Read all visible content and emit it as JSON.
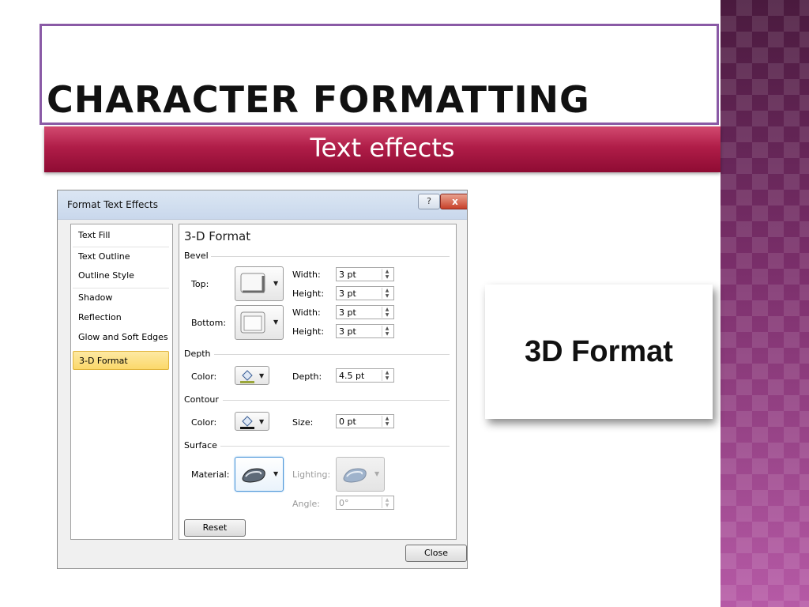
{
  "slide": {
    "title": "CHARACTER FORMATTING",
    "subtitle": "Text effects",
    "callout": "3D Format"
  },
  "colors": {
    "subtitle_bar": "#b01d48",
    "title_border": "#8a5aa6",
    "side_band": "#7a2f6a",
    "active_item": "#fbd86a"
  },
  "dialog": {
    "title": "Format Text Effects",
    "help_label": "?",
    "close_glyph": "x",
    "sidebar": [
      {
        "label": "Text Fill"
      },
      {
        "label": "Text Outline"
      },
      {
        "label": "Outline Style"
      },
      {
        "label": "Shadow"
      },
      {
        "label": "Reflection"
      },
      {
        "label": "Glow and Soft Edges"
      },
      {
        "label": "3-D Format"
      }
    ],
    "active_item": "3-D Format",
    "pane_title": "3-D Format",
    "bevel": {
      "group": "Bevel",
      "top_label": "Top:",
      "bottom_label": "Bottom:",
      "width_label": "Width:",
      "height_label": "Height:",
      "top_width": "3 pt",
      "top_height": "3 pt",
      "bottom_width": "3 pt",
      "bottom_height": "3 pt"
    },
    "depth": {
      "group": "Depth",
      "color_label": "Color:",
      "depth_label": "Depth:",
      "depth_value": "4.5 pt"
    },
    "contour": {
      "group": "Contour",
      "color_label": "Color:",
      "size_label": "Size:",
      "size_value": "0 pt"
    },
    "surface": {
      "group": "Surface",
      "material_label": "Material:",
      "lighting_label": "Lighting:",
      "angle_label": "Angle:",
      "angle_value": "0°"
    },
    "reset_label": "Reset",
    "close_label": "Close"
  }
}
